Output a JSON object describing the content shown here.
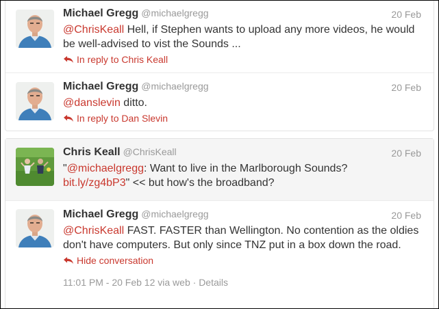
{
  "tweets": [
    {
      "fullname": "Michael Gregg",
      "username": "@michaelgregg",
      "time": "20 Feb",
      "mention": "@ChrisKeall",
      "text_after": " Hell, if Stephen wants to upload any more videos, he would be well-advised to vist the Sounds ...",
      "reply_label": "In reply to Chris Keall",
      "avatar": "michael-gregg-avatar"
    },
    {
      "fullname": "Michael Gregg",
      "username": "@michaelgregg",
      "time": "20 Feb",
      "mention": "@danslevin",
      "text_after": " ditto.",
      "reply_label": "In reply to Dan Slevin",
      "avatar": "michael-gregg-avatar"
    },
    {
      "fullname": "Chris Keall",
      "username": "@ChrisKeall",
      "time": "20 Feb",
      "quote_open": "\"",
      "mention": "@michaelgregg",
      "text_mid": ": Want to live in the Marlborough Sounds?",
      "link": "bit.ly/zg4bP3",
      "text_after": "\" << but how's the broadband?",
      "avatar": "chris-keall-avatar"
    },
    {
      "fullname": "Michael Gregg",
      "username": "@michaelgregg",
      "time": "20 Feb",
      "mention": "@ChrisKeall",
      "text_after": " FAST. FASTER than Wellington. No contention as the oldies don't have computers. But only since TNZ put in a box down the road.",
      "hide_label": "Hide conversation",
      "timestamp": "11:01 PM - 20 Feb 12 via web",
      "separator": "·",
      "details_label": "Details",
      "avatar": "michael-gregg-avatar"
    }
  ],
  "colors": {
    "link": "#c9382e",
    "muted": "#999999",
    "text": "#333333"
  },
  "icons": {
    "reply": "reply-arrow-icon"
  }
}
